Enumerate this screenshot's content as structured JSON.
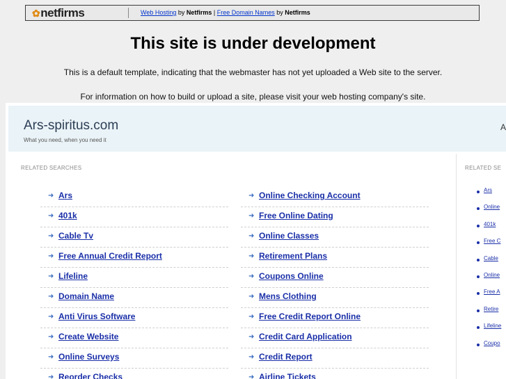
{
  "topbar": {
    "logo_text": "netfirms",
    "link1": "Web Hosting",
    "by1": " by ",
    "brand1": "Netfirms",
    "pipe": " | ",
    "link2": "Free Domain Names",
    "by2": " by ",
    "brand2": "Netfirms"
  },
  "notice": {
    "title": "This site is under development",
    "line1": "This is a default template, indicating that the webmaster has not yet uploaded a Web site to the server.",
    "line2": "For information on how to build or upload a site, please visit your web hosting company's site."
  },
  "parked": {
    "site_name": "Ars-spiritus.com",
    "tagline": "What you need, when you need it",
    "related_label": "RELATED SEARCHES",
    "side_label": "RELATED SE",
    "header_right": "A"
  },
  "col1": [
    "Ars",
    "401k",
    "Cable Tv",
    "Free Annual Credit Report",
    "Lifeline",
    "Domain Name",
    "Anti Virus Software",
    "Create Website",
    "Online Surveys",
    "Reorder Checks"
  ],
  "col2": [
    "Online Checking Account",
    "Free Online Dating",
    "Online Classes",
    "Retirement Plans",
    "Coupons Online",
    "Mens Clothing",
    "Free Credit Report Online",
    "Credit Card Application",
    "Credit Report",
    "Airline Tickets"
  ],
  "side": [
    "Ars",
    "Online",
    "401k",
    "Free C",
    "Cable",
    "Online",
    "Free A",
    "Retire",
    "Lifeline",
    "Coupo"
  ],
  "icons": {
    "arrow": "arrow-right-icon",
    "bullet": "bullet-icon",
    "logo": "netfirms-logo"
  },
  "colors": {
    "link": "#1a2fa8",
    "arrow": "#3a6cc0",
    "header_bg": "#eaf3f7",
    "page_bg": "#efefef"
  }
}
